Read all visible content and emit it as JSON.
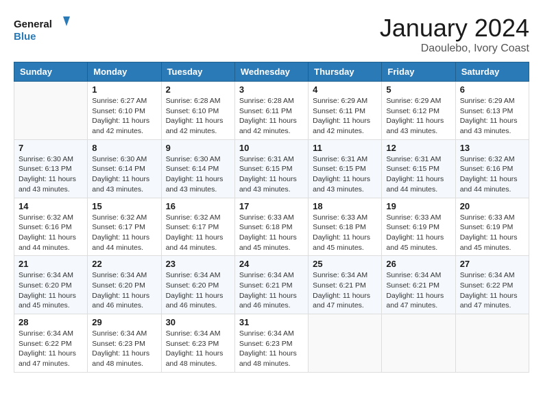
{
  "header": {
    "logo_general": "General",
    "logo_blue": "Blue",
    "month_title": "January 2024",
    "location": "Daoulebo, Ivory Coast"
  },
  "weekdays": [
    "Sunday",
    "Monday",
    "Tuesday",
    "Wednesday",
    "Thursday",
    "Friday",
    "Saturday"
  ],
  "weeks": [
    [
      {
        "day": "",
        "sunrise": "",
        "sunset": "",
        "daylight": ""
      },
      {
        "day": "1",
        "sunrise": "Sunrise: 6:27 AM",
        "sunset": "Sunset: 6:10 PM",
        "daylight": "Daylight: 11 hours and 42 minutes."
      },
      {
        "day": "2",
        "sunrise": "Sunrise: 6:28 AM",
        "sunset": "Sunset: 6:10 PM",
        "daylight": "Daylight: 11 hours and 42 minutes."
      },
      {
        "day": "3",
        "sunrise": "Sunrise: 6:28 AM",
        "sunset": "Sunset: 6:11 PM",
        "daylight": "Daylight: 11 hours and 42 minutes."
      },
      {
        "day": "4",
        "sunrise": "Sunrise: 6:29 AM",
        "sunset": "Sunset: 6:11 PM",
        "daylight": "Daylight: 11 hours and 42 minutes."
      },
      {
        "day": "5",
        "sunrise": "Sunrise: 6:29 AM",
        "sunset": "Sunset: 6:12 PM",
        "daylight": "Daylight: 11 hours and 43 minutes."
      },
      {
        "day": "6",
        "sunrise": "Sunrise: 6:29 AM",
        "sunset": "Sunset: 6:13 PM",
        "daylight": "Daylight: 11 hours and 43 minutes."
      }
    ],
    [
      {
        "day": "7",
        "sunrise": "Sunrise: 6:30 AM",
        "sunset": "Sunset: 6:13 PM",
        "daylight": "Daylight: 11 hours and 43 minutes."
      },
      {
        "day": "8",
        "sunrise": "Sunrise: 6:30 AM",
        "sunset": "Sunset: 6:14 PM",
        "daylight": "Daylight: 11 hours and 43 minutes."
      },
      {
        "day": "9",
        "sunrise": "Sunrise: 6:30 AM",
        "sunset": "Sunset: 6:14 PM",
        "daylight": "Daylight: 11 hours and 43 minutes."
      },
      {
        "day": "10",
        "sunrise": "Sunrise: 6:31 AM",
        "sunset": "Sunset: 6:15 PM",
        "daylight": "Daylight: 11 hours and 43 minutes."
      },
      {
        "day": "11",
        "sunrise": "Sunrise: 6:31 AM",
        "sunset": "Sunset: 6:15 PM",
        "daylight": "Daylight: 11 hours and 43 minutes."
      },
      {
        "day": "12",
        "sunrise": "Sunrise: 6:31 AM",
        "sunset": "Sunset: 6:15 PM",
        "daylight": "Daylight: 11 hours and 44 minutes."
      },
      {
        "day": "13",
        "sunrise": "Sunrise: 6:32 AM",
        "sunset": "Sunset: 6:16 PM",
        "daylight": "Daylight: 11 hours and 44 minutes."
      }
    ],
    [
      {
        "day": "14",
        "sunrise": "Sunrise: 6:32 AM",
        "sunset": "Sunset: 6:16 PM",
        "daylight": "Daylight: 11 hours and 44 minutes."
      },
      {
        "day": "15",
        "sunrise": "Sunrise: 6:32 AM",
        "sunset": "Sunset: 6:17 PM",
        "daylight": "Daylight: 11 hours and 44 minutes."
      },
      {
        "day": "16",
        "sunrise": "Sunrise: 6:32 AM",
        "sunset": "Sunset: 6:17 PM",
        "daylight": "Daylight: 11 hours and 44 minutes."
      },
      {
        "day": "17",
        "sunrise": "Sunrise: 6:33 AM",
        "sunset": "Sunset: 6:18 PM",
        "daylight": "Daylight: 11 hours and 45 minutes."
      },
      {
        "day": "18",
        "sunrise": "Sunrise: 6:33 AM",
        "sunset": "Sunset: 6:18 PM",
        "daylight": "Daylight: 11 hours and 45 minutes."
      },
      {
        "day": "19",
        "sunrise": "Sunrise: 6:33 AM",
        "sunset": "Sunset: 6:19 PM",
        "daylight": "Daylight: 11 hours and 45 minutes."
      },
      {
        "day": "20",
        "sunrise": "Sunrise: 6:33 AM",
        "sunset": "Sunset: 6:19 PM",
        "daylight": "Daylight: 11 hours and 45 minutes."
      }
    ],
    [
      {
        "day": "21",
        "sunrise": "Sunrise: 6:34 AM",
        "sunset": "Sunset: 6:20 PM",
        "daylight": "Daylight: 11 hours and 45 minutes."
      },
      {
        "day": "22",
        "sunrise": "Sunrise: 6:34 AM",
        "sunset": "Sunset: 6:20 PM",
        "daylight": "Daylight: 11 hours and 46 minutes."
      },
      {
        "day": "23",
        "sunrise": "Sunrise: 6:34 AM",
        "sunset": "Sunset: 6:20 PM",
        "daylight": "Daylight: 11 hours and 46 minutes."
      },
      {
        "day": "24",
        "sunrise": "Sunrise: 6:34 AM",
        "sunset": "Sunset: 6:21 PM",
        "daylight": "Daylight: 11 hours and 46 minutes."
      },
      {
        "day": "25",
        "sunrise": "Sunrise: 6:34 AM",
        "sunset": "Sunset: 6:21 PM",
        "daylight": "Daylight: 11 hours and 47 minutes."
      },
      {
        "day": "26",
        "sunrise": "Sunrise: 6:34 AM",
        "sunset": "Sunset: 6:21 PM",
        "daylight": "Daylight: 11 hours and 47 minutes."
      },
      {
        "day": "27",
        "sunrise": "Sunrise: 6:34 AM",
        "sunset": "Sunset: 6:22 PM",
        "daylight": "Daylight: 11 hours and 47 minutes."
      }
    ],
    [
      {
        "day": "28",
        "sunrise": "Sunrise: 6:34 AM",
        "sunset": "Sunset: 6:22 PM",
        "daylight": "Daylight: 11 hours and 47 minutes."
      },
      {
        "day": "29",
        "sunrise": "Sunrise: 6:34 AM",
        "sunset": "Sunset: 6:23 PM",
        "daylight": "Daylight: 11 hours and 48 minutes."
      },
      {
        "day": "30",
        "sunrise": "Sunrise: 6:34 AM",
        "sunset": "Sunset: 6:23 PM",
        "daylight": "Daylight: 11 hours and 48 minutes."
      },
      {
        "day": "31",
        "sunrise": "Sunrise: 6:34 AM",
        "sunset": "Sunset: 6:23 PM",
        "daylight": "Daylight: 11 hours and 48 minutes."
      },
      {
        "day": "",
        "sunrise": "",
        "sunset": "",
        "daylight": ""
      },
      {
        "day": "",
        "sunrise": "",
        "sunset": "",
        "daylight": ""
      },
      {
        "day": "",
        "sunrise": "",
        "sunset": "",
        "daylight": ""
      }
    ]
  ]
}
